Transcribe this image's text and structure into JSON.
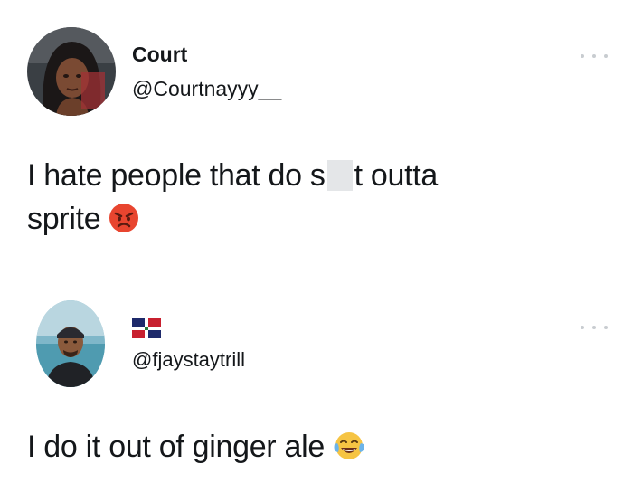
{
  "tweets": [
    {
      "display_name": "Court",
      "handle": "@Courtnayyy__",
      "text_line1_a": "I hate people that do s",
      "text_line1_b": "t outta",
      "text_line2": "sprite",
      "emoji": "angry-face-emoji"
    },
    {
      "display_name_flag": "dominican-republic-flag-icon",
      "handle": "@fjaystaytrill",
      "text": "I do it out of ginger ale",
      "emoji": "face-with-tears-of-joy-emoji"
    }
  ],
  "colors": {
    "text": "#14171a",
    "dots": "#c8ccd0",
    "censor": "#e4e6e8"
  }
}
